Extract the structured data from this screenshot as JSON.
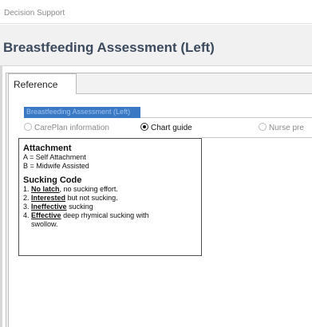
{
  "window": {
    "title": "Decision Support"
  },
  "header": {
    "heading": "Breastfeeding Assessment (Left)"
  },
  "tabs": [
    {
      "label": "Reference",
      "selected": true
    }
  ],
  "dropdown": {
    "value": "Breastfeeding Assessment (Left)"
  },
  "radio_options": [
    {
      "label": "CarePlan information",
      "selected": false
    },
    {
      "label": "Chart guide",
      "selected": true
    },
    {
      "label": "Nurse pre",
      "selected": false
    }
  ],
  "guide": {
    "attachment": {
      "title": "Attachment",
      "lines": [
        "A = Self Attachment",
        "B = Midwife Assisted"
      ]
    },
    "sucking": {
      "title": "Sucking Code",
      "items": [
        {
          "num": "1.",
          "key": "No latch",
          "rest": ", no sucking effort."
        },
        {
          "num": "2.",
          "key": "Interested",
          "rest": " but not sucking."
        },
        {
          "num": "3.",
          "key": "Ineffective",
          "rest": " sucking"
        },
        {
          "num": "4.",
          "key": "Effective",
          "rest": " deep rhymical sucking with",
          "cont": "swollow."
        }
      ]
    }
  }
}
